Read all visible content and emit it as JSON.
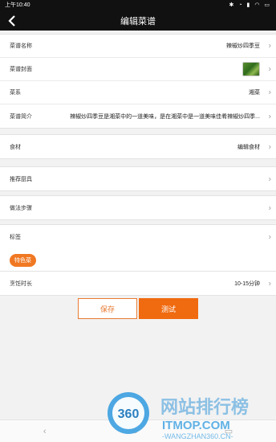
{
  "status_bar": {
    "time": "上午10:40",
    "icons": "✱ ◔ ▮ ◠ ▭"
  },
  "header": {
    "title": "编辑菜谱",
    "back_icon": "chevron-left-icon"
  },
  "basic": {
    "name_label": "菜谱名称",
    "name_value": "辣椒炒四季豆",
    "cover_label": "菜谱封面",
    "category_label": "菜系",
    "category_value": "湘菜",
    "intro_label": "菜谱简介",
    "intro_value": "辣椒炒四季豆是湘菜中的一道美味，是在湘菜中是一道美味佳肴辣椒炒四季..."
  },
  "ingredients": {
    "label": "食材",
    "value": "编辑食材"
  },
  "tools": {
    "label": "推荐厨具"
  },
  "steps": {
    "label": "做法步骤"
  },
  "tags": {
    "label": "标签",
    "items": [
      "特色菜"
    ]
  },
  "cook_time": {
    "label": "烹饪时长",
    "value": "10-15分钟"
  },
  "actions": {
    "save": "保存",
    "test": "测试"
  },
  "watermark": {
    "brand": "360",
    "text": "网站排行榜",
    "domain": "ITMOP.COM",
    "sub": "-WANGZHAN360.CN-"
  },
  "colors": {
    "accent": "#f06a10",
    "header_bg": "#111111",
    "page_bg": "#f2f2f2"
  }
}
